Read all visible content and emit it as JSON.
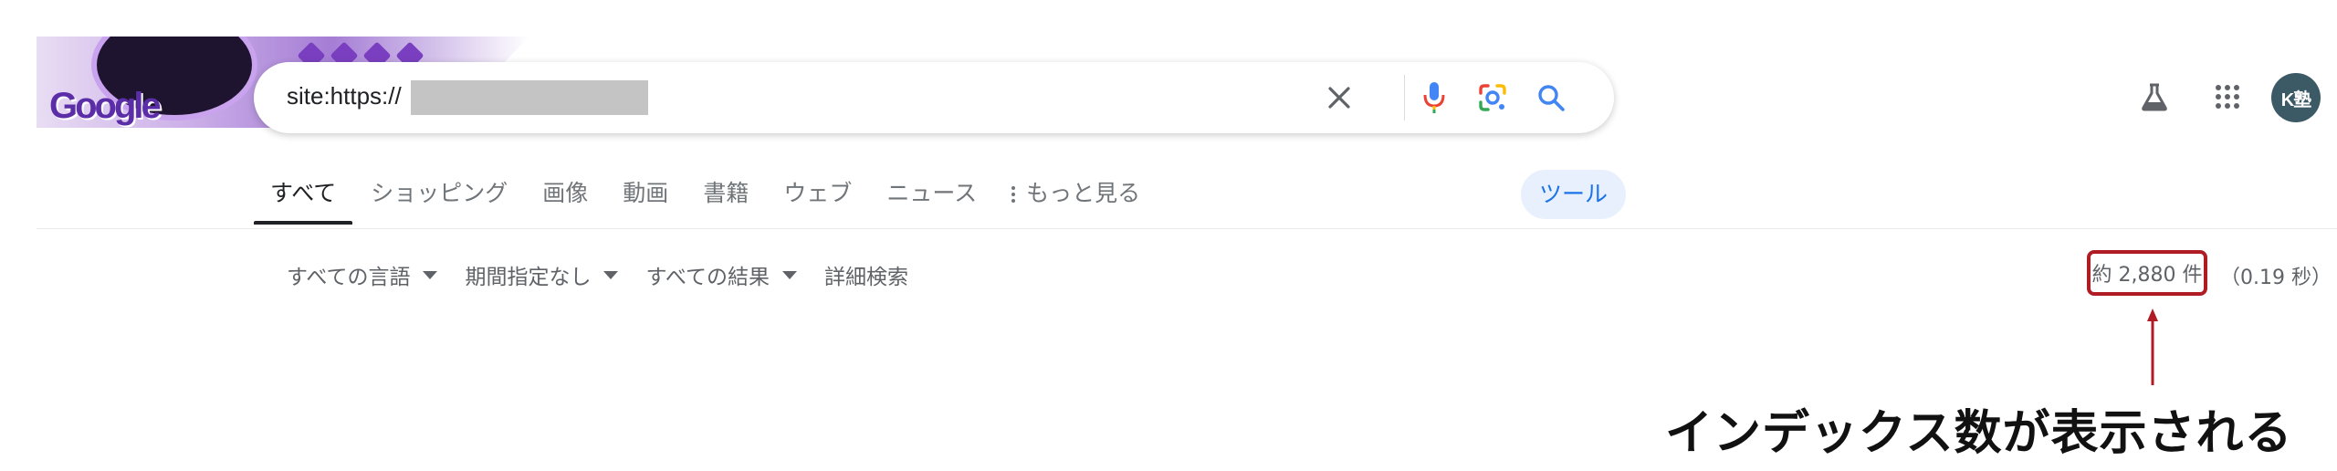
{
  "logo": {
    "alt": "Google"
  },
  "search": {
    "query": "site:https://",
    "clear_icon": "close-icon",
    "voice_icon": "mic-icon",
    "lens_icon": "camera-lens-icon",
    "search_icon": "search-icon"
  },
  "header": {
    "labs_icon": "flask-icon",
    "apps_icon": "apps-grid-icon",
    "avatar_text": "K塾"
  },
  "tabs": [
    {
      "label": "すべて",
      "active": true
    },
    {
      "label": "ショッピング"
    },
    {
      "label": "画像"
    },
    {
      "label": "動画"
    },
    {
      "label": "書籍"
    },
    {
      "label": "ウェブ"
    },
    {
      "label": "ニュース"
    },
    {
      "label": "もっと見る"
    }
  ],
  "tools_label": "ツール",
  "filters": [
    {
      "label": "すべての言語",
      "dropdown": true
    },
    {
      "label": "期間指定なし",
      "dropdown": true
    },
    {
      "label": "すべての結果",
      "dropdown": true
    },
    {
      "label": "詳細検索",
      "dropdown": false
    }
  ],
  "result_stats": {
    "count": "約 2,880 件",
    "time": "（0.19 秒）"
  },
  "annotation": {
    "text": "インデックス数が表示される",
    "color": "#b01c24"
  },
  "colors": {
    "accent_blue": "#1a73e8",
    "highlight_red": "#b01c24",
    "tools_bg": "#e8f0fe"
  }
}
